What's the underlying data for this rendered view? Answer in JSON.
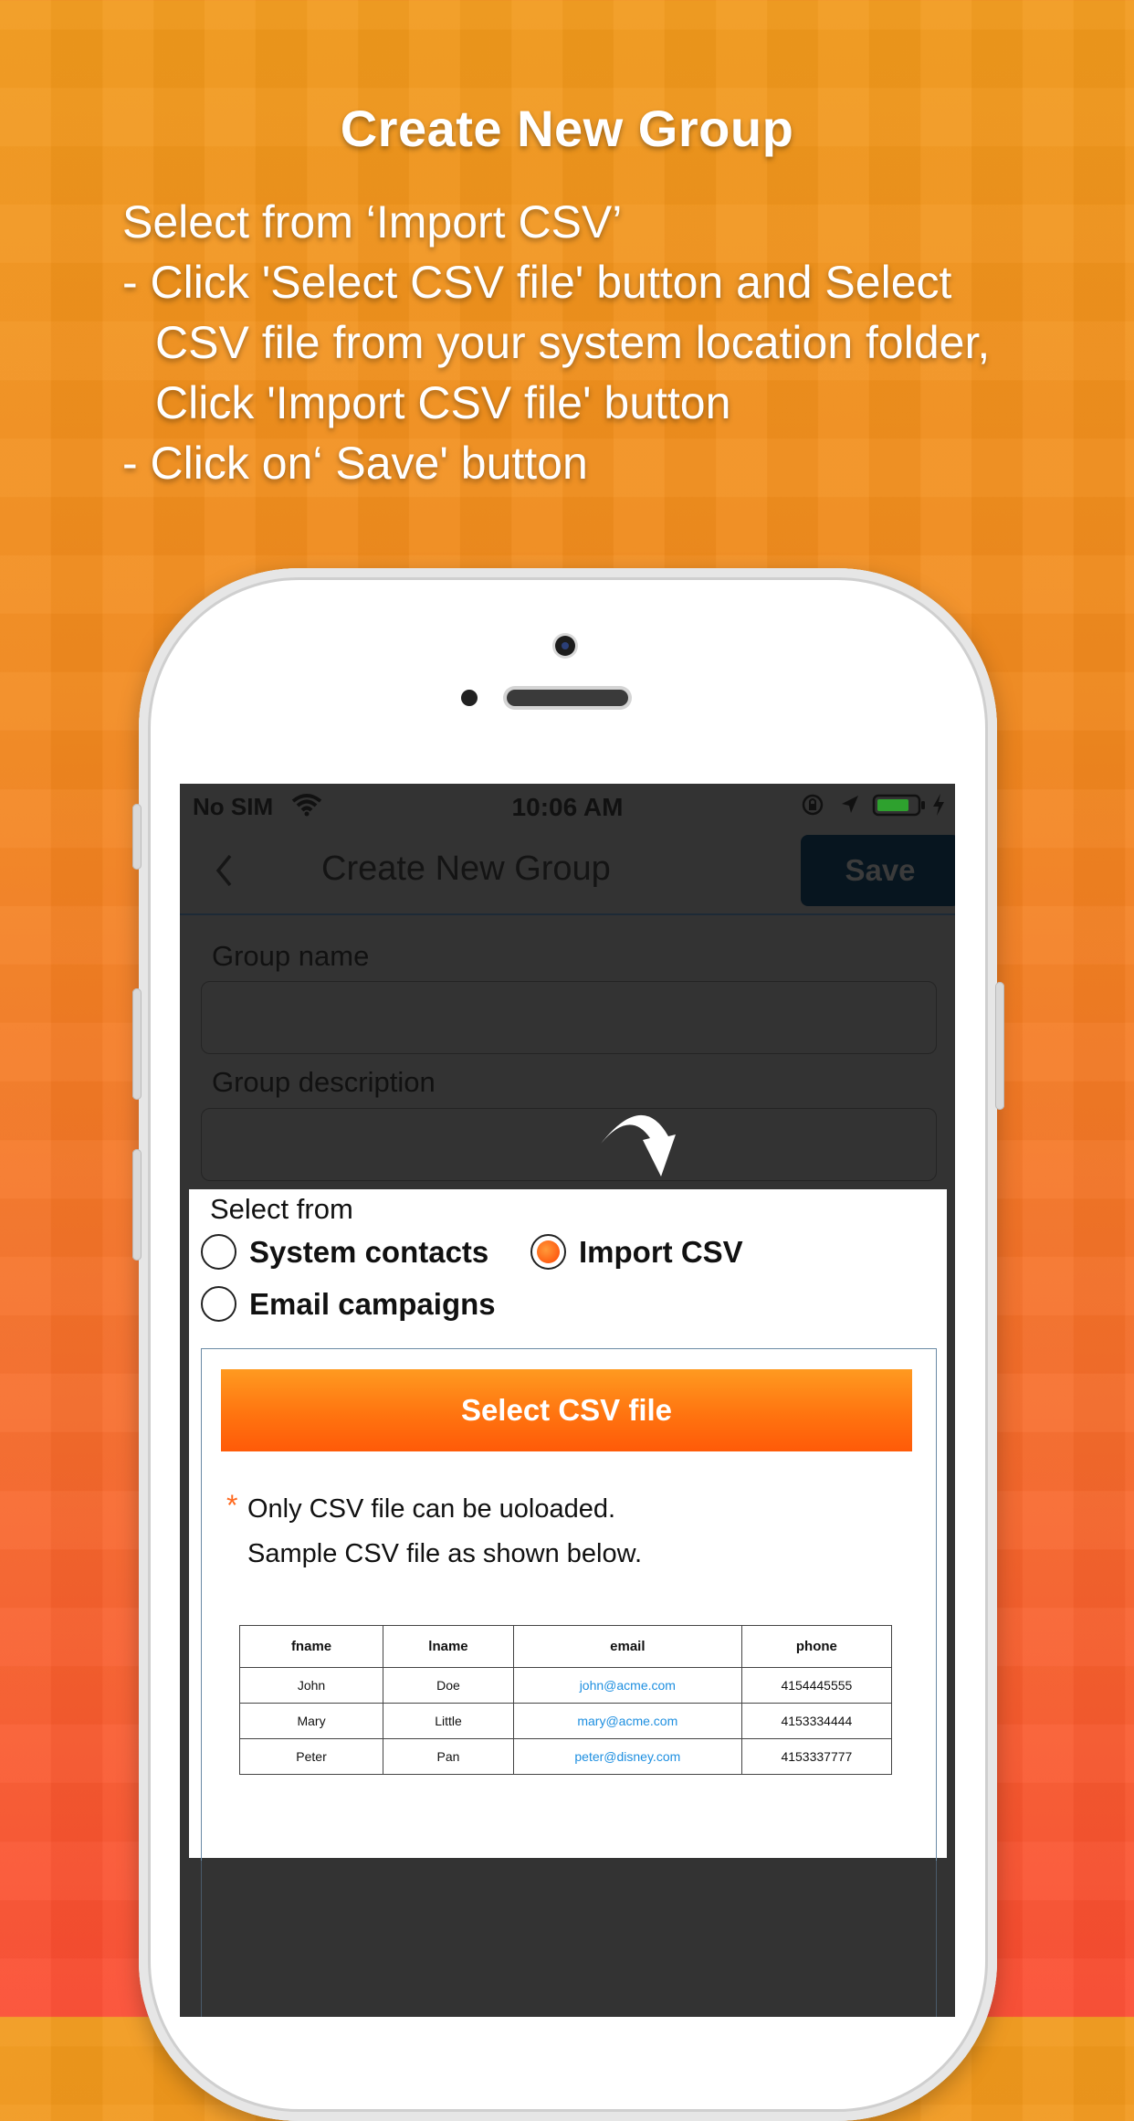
{
  "promo": {
    "title": "Create New Group",
    "line1": "Select from ‘Import CSV’",
    "line2": "- Click 'Select CSV file' button and Select",
    "line3": "CSV file from your system location folder,",
    "line4": "Click 'Import CSV file' button",
    "line5": "- Click on‘ Save' button"
  },
  "status_bar": {
    "carrier": "No SIM",
    "time": "10:06 AM",
    "battery_color": "#2ea12e"
  },
  "nav": {
    "title": "Create New Group",
    "save_label": "Save"
  },
  "form": {
    "group_name_label": "Group name",
    "group_description_label": "Group description",
    "select_from_label": "Select from",
    "options": [
      {
        "label": "System contacts",
        "checked": false
      },
      {
        "label": "Import CSV",
        "checked": true
      },
      {
        "label": "Email campaigns",
        "checked": false
      }
    ],
    "select_csv_label": "Select CSV file",
    "note_line1": "Only CSV file can be uoloaded.",
    "note_line2": "Sample CSV file as shown below.",
    "note_marker": "*"
  },
  "sample_table": {
    "headers": [
      "fname",
      "lname",
      "email",
      "phone"
    ],
    "rows": [
      [
        "John",
        "Doe",
        "john@acme.com",
        "4154445555"
      ],
      [
        "Mary",
        "Little",
        "mary@acme.com",
        "4153334444"
      ],
      [
        "Peter",
        "Pan",
        "peter@disney.com",
        "4153337777"
      ]
    ]
  },
  "colors": {
    "accent": "#ff7410",
    "screen_bg": "#333333",
    "email_link": "#1e8fe0"
  }
}
